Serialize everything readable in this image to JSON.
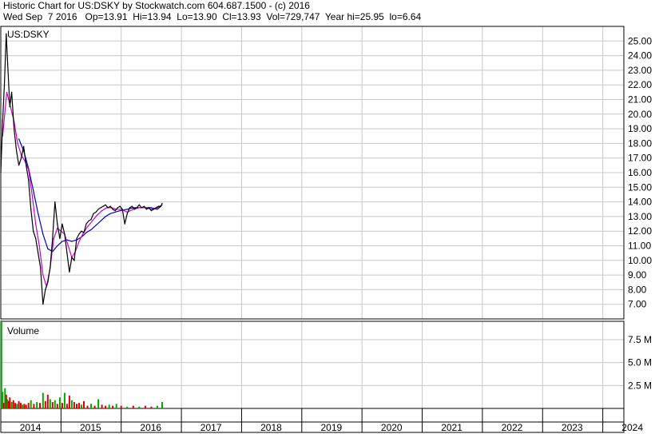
{
  "header": {
    "line1": "Historic Chart for US:DSKY by Stockwatch.com 604.687.1500 - (c) 2016",
    "line2": "Wed Sep  7 2016   Op=13.91  Hi=13.94  Lo=13.90  Cl=13.93  Vol=729,747  Year hi=25.95  lo=6.64"
  },
  "colors": {
    "price": "#000000",
    "ma_short": "#cc00cc",
    "ma_long": "#0000cc",
    "vol_up": "#00aa00",
    "vol_down": "#dd0000",
    "grid": "#c8c8c8"
  },
  "chart_data": [
    {
      "type": "line",
      "title": "US:DSKY",
      "ylim": [
        6,
        26
      ],
      "yticks": [
        7,
        8,
        9,
        10,
        11,
        12,
        13,
        14,
        15,
        16,
        17,
        18,
        19,
        20,
        21,
        22,
        23,
        24,
        25
      ],
      "ytick_labels": [
        "7.00",
        "8.00",
        "9.00",
        "10.00",
        "11.00",
        "12.00",
        "13.00",
        "14.00",
        "15.00",
        "16.00",
        "17.00",
        "18.00",
        "19.00",
        "20.00",
        "21.00",
        "22.00",
        "23.00",
        "24.00",
        "25.00"
      ],
      "xlim": [
        2014.0,
        2024.35
      ],
      "x_tick_labels": [
        "2014",
        "2015",
        "2016",
        "2017",
        "2018",
        "2019",
        "2020",
        "2021",
        "2022",
        "2023",
        "2024"
      ],
      "grid": true,
      "series": [
        {
          "role": "price",
          "x": [
            2014.0,
            2014.03,
            2014.06,
            2014.09,
            2014.12,
            2014.15,
            2014.18,
            2014.22,
            2014.26,
            2014.3,
            2014.34,
            2014.38,
            2014.42,
            2014.46,
            2014.5,
            2014.54,
            2014.58,
            2014.62,
            2014.66,
            2014.7,
            2014.74,
            2014.78,
            2014.82,
            2014.86,
            2014.9,
            2014.94,
            2014.98,
            2015.02,
            2015.06,
            2015.1,
            2015.14,
            2015.18,
            2015.22,
            2015.26,
            2015.3,
            2015.34,
            2015.38,
            2015.42,
            2015.46,
            2015.5,
            2015.54,
            2015.58,
            2015.62,
            2015.66,
            2015.7,
            2015.74,
            2015.78,
            2015.82,
            2015.86,
            2015.9,
            2015.94,
            2015.98,
            2016.02,
            2016.06,
            2016.1,
            2016.14,
            2016.18,
            2016.22,
            2016.26,
            2016.3,
            2016.34,
            2016.38,
            2016.42,
            2016.46,
            2016.5,
            2016.54,
            2016.58,
            2016.62,
            2016.66,
            2016.68
          ],
          "y": [
            16.0,
            19.5,
            22.0,
            25.5,
            23.0,
            20.5,
            21.5,
            19.0,
            17.5,
            16.5,
            17.0,
            17.8,
            16.5,
            15.5,
            13.5,
            12.0,
            11.5,
            10.5,
            9.5,
            7.0,
            8.0,
            8.5,
            9.5,
            11.5,
            14.0,
            12.5,
            11.5,
            12.5,
            11.8,
            10.5,
            9.2,
            10.2,
            10.0,
            11.5,
            11.8,
            12.0,
            11.9,
            12.5,
            12.7,
            12.8,
            13.2,
            13.3,
            13.5,
            13.6,
            13.7,
            13.8,
            13.6,
            13.7,
            13.5,
            13.4,
            13.6,
            13.7,
            13.5,
            12.5,
            13.2,
            13.6,
            13.7,
            13.5,
            13.6,
            13.8,
            13.6,
            13.7,
            13.5,
            13.6,
            13.4,
            13.5,
            13.6,
            13.7,
            13.7,
            13.9
          ]
        },
        {
          "role": "ma_short",
          "x": [
            2014.03,
            2014.1,
            2014.16,
            2014.22,
            2014.28,
            2014.34,
            2014.4,
            2014.46,
            2014.52,
            2014.58,
            2014.64,
            2014.7,
            2014.76,
            2014.82,
            2014.88,
            2014.94,
            2015.0,
            2015.06,
            2015.12,
            2015.18,
            2015.24,
            2015.3,
            2015.36,
            2015.44,
            2015.52,
            2015.6,
            2015.68,
            2015.76,
            2015.84,
            2015.92,
            2016.0,
            2016.1,
            2016.2,
            2016.3,
            2016.4,
            2016.5,
            2016.6,
            2016.68
          ],
          "y": [
            18.5,
            21.5,
            20.5,
            19.5,
            18.0,
            17.2,
            16.8,
            16.2,
            14.5,
            12.5,
            11.0,
            9.0,
            8.2,
            9.5,
            11.5,
            12.2,
            12.0,
            11.8,
            11.0,
            10.2,
            10.6,
            11.3,
            11.8,
            12.3,
            12.7,
            13.1,
            13.4,
            13.6,
            13.6,
            13.5,
            13.5,
            13.3,
            13.5,
            13.6,
            13.6,
            13.5,
            13.6,
            13.8
          ]
        },
        {
          "role": "ma_long",
          "x": [
            2014.3,
            2014.38,
            2014.46,
            2014.54,
            2014.62,
            2014.7,
            2014.78,
            2014.86,
            2014.94,
            2015.02,
            2015.1,
            2015.18,
            2015.26,
            2015.34,
            2015.42,
            2015.5,
            2015.58,
            2015.66,
            2015.74,
            2015.82,
            2015.9,
            2015.98,
            2016.1,
            2016.2,
            2016.3,
            2016.4,
            2016.5,
            2016.6,
            2016.66
          ],
          "y": [
            18.3,
            17.5,
            16.3,
            14.8,
            13.2,
            11.8,
            10.8,
            10.6,
            11.0,
            11.3,
            11.4,
            11.3,
            11.4,
            11.6,
            11.9,
            12.1,
            12.4,
            12.7,
            13.0,
            13.2,
            13.3,
            13.4,
            13.5,
            13.6,
            13.6,
            13.6,
            13.6,
            13.5,
            13.7
          ]
        }
      ]
    },
    {
      "type": "bar",
      "title": "Volume",
      "ylim": [
        0,
        9.5
      ],
      "ytick_values": [
        2.5,
        5.0,
        7.5
      ],
      "ytick_labels": [
        "2.5 M",
        "5.0 M",
        "7.5 M"
      ],
      "x": [
        2014.01,
        2014.03,
        2014.05,
        2014.07,
        2014.09,
        2014.11,
        2014.13,
        2014.15,
        2014.18,
        2014.21,
        2014.24,
        2014.27,
        2014.3,
        2014.33,
        2014.36,
        2014.39,
        2014.42,
        2014.46,
        2014.5,
        2014.55,
        2014.6,
        2014.65,
        2014.7,
        2014.74,
        2014.78,
        2014.82,
        2014.86,
        2014.9,
        2014.94,
        2014.98,
        2015.02,
        2015.06,
        2015.1,
        2015.14,
        2015.18,
        2015.22,
        2015.26,
        2015.3,
        2015.34,
        2015.38,
        2015.44,
        2015.5,
        2015.56,
        2015.62,
        2015.68,
        2015.74,
        2015.8,
        2015.86,
        2015.92,
        2016.0,
        2016.1,
        2016.2,
        2016.3,
        2016.4,
        2016.5,
        2016.6,
        2016.68
      ],
      "values": [
        9.6,
        1.8,
        0.6,
        2.2,
        1.5,
        1.0,
        0.8,
        1.2,
        0.7,
        0.9,
        0.6,
        0.5,
        0.8,
        0.6,
        0.4,
        0.5,
        0.4,
        0.6,
        0.9,
        0.5,
        0.7,
        0.6,
        1.7,
        0.8,
        1.5,
        1.0,
        0.7,
        0.9,
        0.5,
        1.2,
        0.6,
        1.7,
        0.5,
        1.4,
        0.9,
        0.7,
        0.5,
        0.6,
        0.4,
        0.8,
        0.3,
        0.5,
        0.3,
        1.0,
        0.4,
        0.3,
        0.4,
        0.3,
        0.5,
        0.3,
        0.2,
        0.3,
        0.2,
        0.3,
        0.2,
        0.3,
        0.7
      ],
      "up": [
        true,
        true,
        false,
        true,
        false,
        true,
        false,
        false,
        true,
        false,
        false,
        true,
        false,
        false,
        true,
        false,
        false,
        false,
        true,
        false,
        true,
        false,
        true,
        false,
        false,
        true,
        false,
        true,
        false,
        true,
        false,
        true,
        false,
        false,
        true,
        false,
        false,
        false,
        true,
        false,
        false,
        true,
        false,
        true,
        false,
        false,
        true,
        false,
        true,
        false,
        true,
        false,
        true,
        false,
        false,
        true,
        true
      ]
    }
  ]
}
